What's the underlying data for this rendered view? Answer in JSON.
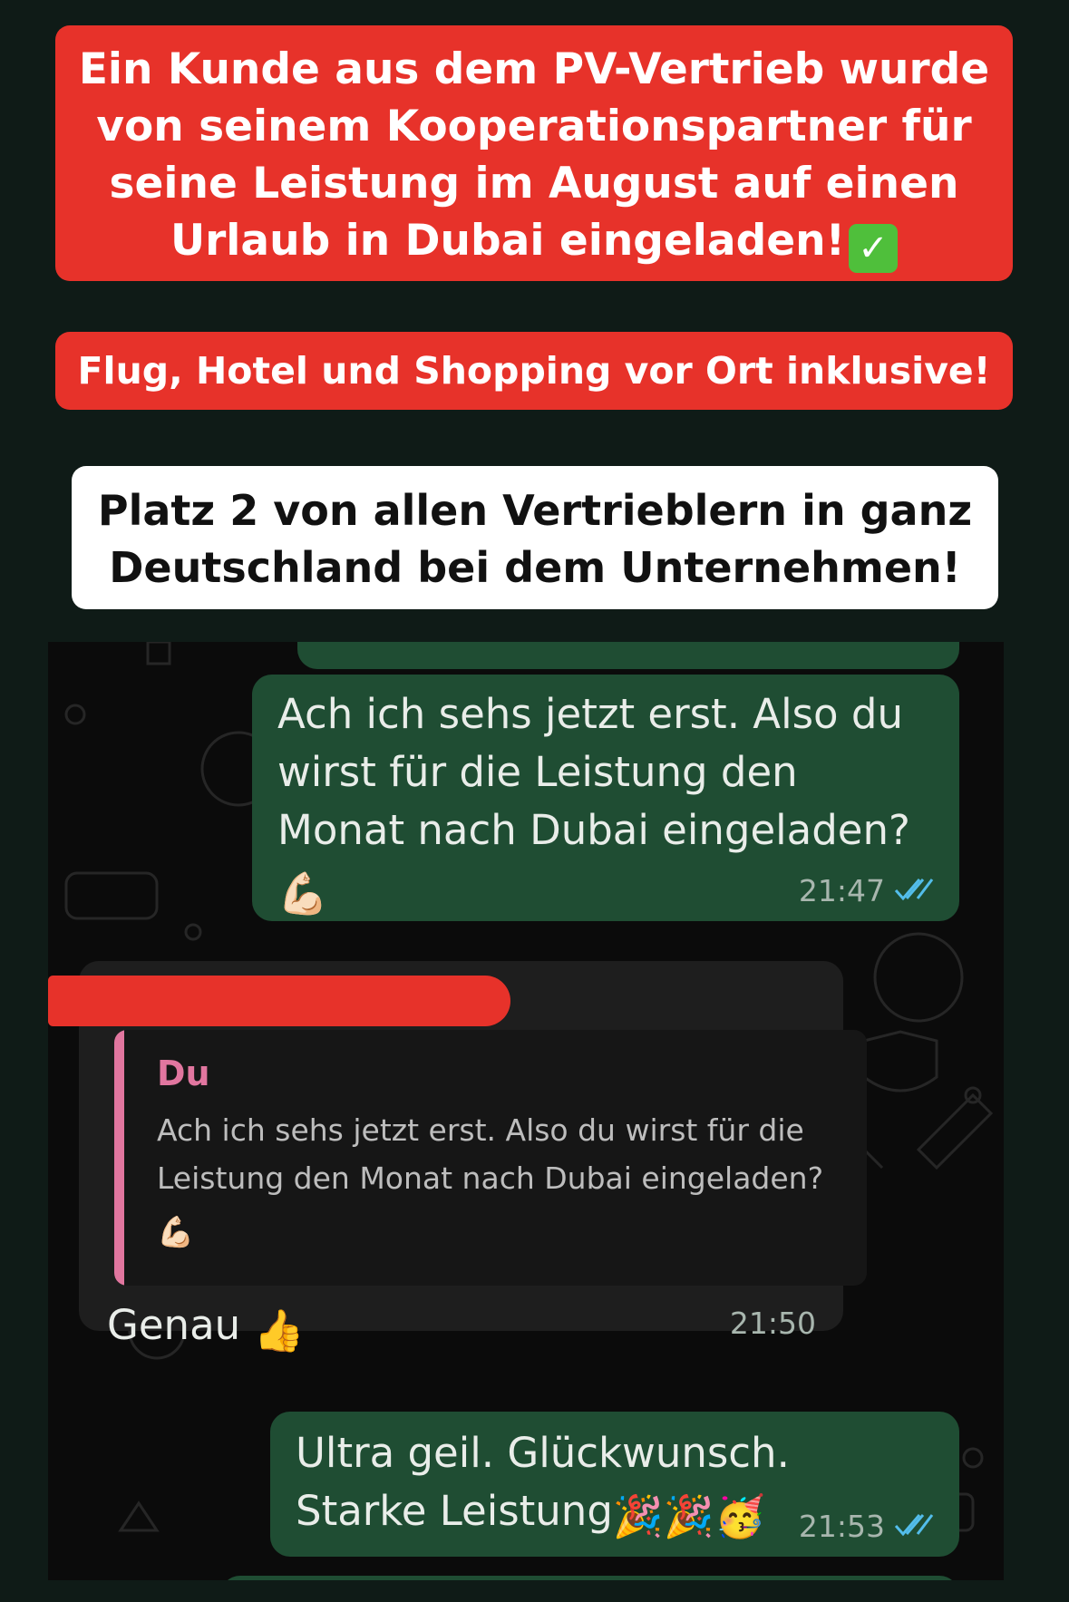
{
  "banners": {
    "headline": "Ein Kunde aus dem PV-Vertrieb wurde von seinem Kooperationspartner für seine Leistung im August auf einen Urlaub in Dubai eingeladen!",
    "headline_emoji": "✅",
    "subline": "Flug, Hotel und Shopping vor Ort inklusive!",
    "ranking": "Platz 2 von allen Vertrieblern in ganz Deutschland bei dem Unternehmen!"
  },
  "chat": {
    "messages": [
      {
        "type": "outgoing",
        "text": "Ach ich sehs jetzt erst. Also du wirst für die Leistung den Monat nach Dubai eingeladen?",
        "emoji": "💪🏻",
        "time": "21:47",
        "status": "read"
      },
      {
        "type": "incoming",
        "quote": {
          "author": "Du",
          "text": "Ach ich sehs jetzt erst. Also du wirst für die Leistung den Monat nach Dubai eingeladen?",
          "emoji": "💪🏻"
        },
        "text": "Genau",
        "emoji": "👍",
        "time": "21:50"
      },
      {
        "type": "outgoing",
        "text": "Ultra geil. Glückwunsch. Starke Leistung",
        "emoji": "🎉🎉🥳",
        "time": "21:53",
        "status": "read"
      }
    ]
  },
  "colors": {
    "banner_red": "#e7322a",
    "outgoing_bubble": "#1f4d33",
    "incoming_bubble": "#1e1e1e",
    "quote_accent": "#e1769f",
    "read_ticks": "#53bdeb"
  },
  "icons": [
    "check-emoji",
    "read-receipt-icon",
    "flexed-biceps-emoji",
    "thumbs-up-emoji",
    "party-popper-emoji",
    "partying-face-emoji"
  ]
}
